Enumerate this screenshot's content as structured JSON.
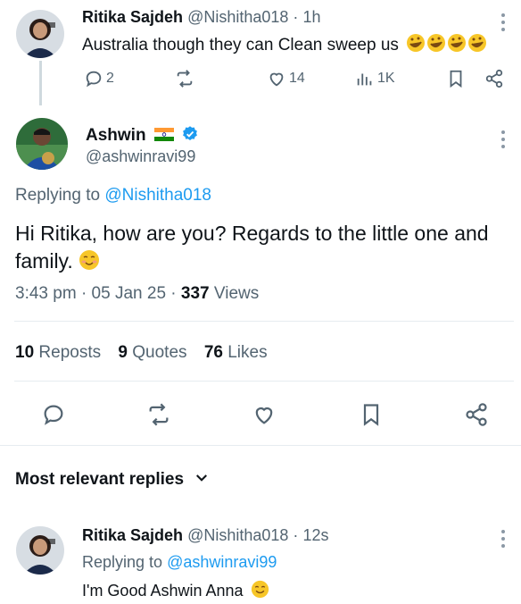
{
  "parent_tweet": {
    "display_name": "Ritika Sajdeh",
    "handle": "@Nishitha018",
    "separator": "·",
    "time": "1h",
    "text": "Australia though they can Clean sweep us",
    "emoji": "rolling-on-floor-laughing x4",
    "actions": {
      "replies": "2",
      "likes": "14",
      "views": "1K"
    }
  },
  "main_tweet": {
    "display_name": "Ashwin",
    "flag": "india-flag-icon",
    "handle": "@ashwinravi99",
    "replying_prefix": "Replying to",
    "replying_handle": "@Nishitha018",
    "text": "Hi Ritika, how are you? Regards to the little one and family.",
    "emoji": "smiling-face-blushing",
    "time": "3:43 pm",
    "dot": "·",
    "date": "05 Jan 25",
    "views_count": "337",
    "views_label": "Views",
    "stats": {
      "reposts_count": "10",
      "reposts_label": "Reposts",
      "quotes_count": "9",
      "quotes_label": "Quotes",
      "likes_count": "76",
      "likes_label": "Likes"
    }
  },
  "replies_section": {
    "sort_label": "Most relevant replies"
  },
  "reply_tweet": {
    "display_name": "Ritika Sajdeh",
    "handle": "@Nishitha018",
    "separator": "·",
    "time": "12s",
    "replying_prefix": "Replying to",
    "replying_handle": "@ashwinravi99",
    "text": "I'm Good Ashwin Anna",
    "emoji": "smiling-face"
  },
  "colors": {
    "text": "#0f1419",
    "muted": "#536471",
    "link": "#1d9bf0",
    "divider": "#e6ecf0",
    "emoji": "#f7c628"
  }
}
